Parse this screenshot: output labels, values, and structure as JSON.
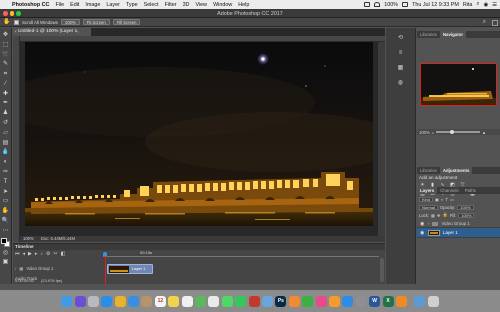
{
  "menubar": {
    "apple": "",
    "app_name": "Photoshop CC",
    "menus": [
      "File",
      "Edit",
      "Image",
      "Layer",
      "Type",
      "Select",
      "Filter",
      "3D",
      "View",
      "Window",
      "Help"
    ],
    "battery": "100%",
    "clock": "Thu Jul 12  9:33 PM",
    "user": "Rita"
  },
  "titlebar": {
    "title": "Adobe Photoshop CC 2017"
  },
  "options": {
    "scroll_all_label": "Scroll All Windows",
    "zoom_value": "100%",
    "fit_screen": "Fit Screen",
    "fill_screen": "Fill Screen"
  },
  "document": {
    "tab_title": "Untitled-1 @ 100% (Layer 1, RGB/8) *",
    "zoom": "100%",
    "doc_size": "Doc: 6.44M/6.44M"
  },
  "panels": {
    "top_tabs": [
      "Libraries",
      "Navigator"
    ],
    "navigator_zoom": "100%",
    "mid_tabs": [
      "Libraries",
      "Adjustments"
    ],
    "adjustments_title": "Add an adjustment",
    "layer_tabs": [
      "Layers",
      "Channels",
      "Paths"
    ],
    "layer_filter": "Kind",
    "blend_mode": "Normal",
    "opacity_label": "Opacity:",
    "opacity_value": "100%",
    "lock_label": "Lock:",
    "fill_label": "Fill:",
    "fill_value": "100%",
    "layers": [
      {
        "name": "Video Group 1",
        "type": "group"
      },
      {
        "name": "Layer 1",
        "type": "layer"
      }
    ]
  },
  "timeline": {
    "title": "Timeline",
    "current_time": "00:15s",
    "track_label": "Video Group 1",
    "clip_label": "Layer 1",
    "audio_label": "Audio Track",
    "timecode": "0:00:00:00",
    "fps": "(23.976 fps)",
    "playhead_fraction": 0.0
  },
  "dock": {
    "apps": [
      {
        "label": "Finder",
        "color": "#3f9be8",
        "glyph": ""
      },
      {
        "label": "Siri",
        "color": "#6a4fd6",
        "glyph": ""
      },
      {
        "label": "Launchpad",
        "color": "#b9b9c4",
        "glyph": ""
      },
      {
        "label": "Safari",
        "color": "#2b8ee6",
        "glyph": ""
      },
      {
        "label": "Chrome",
        "color": "#e8b42a",
        "glyph": ""
      },
      {
        "label": "Mail",
        "color": "#3a8fe0",
        "glyph": ""
      },
      {
        "label": "Contacts",
        "color": "#b8926a",
        "glyph": ""
      },
      {
        "label": "Calendar",
        "color": "#f4f4f4",
        "glyph": "12"
      },
      {
        "label": "Notes",
        "color": "#f3d34a",
        "glyph": ""
      },
      {
        "label": "Reminders",
        "color": "#f0f0f0",
        "glyph": ""
      },
      {
        "label": "Maps",
        "color": "#5cb85c",
        "glyph": ""
      },
      {
        "label": "Photos",
        "color": "#e9e9e9",
        "glyph": ""
      },
      {
        "label": "Messages",
        "color": "#4cd964",
        "glyph": ""
      },
      {
        "label": "FaceTime",
        "color": "#34c759",
        "glyph": ""
      },
      {
        "label": "Photo Booth",
        "color": "#c0392b",
        "glyph": ""
      },
      {
        "label": "Preview",
        "color": "#6aa6d8",
        "glyph": ""
      },
      {
        "label": "Photoshop",
        "color": "#0b2a44",
        "glyph": "Ps"
      },
      {
        "label": "Pages",
        "color": "#f28a30",
        "glyph": ""
      },
      {
        "label": "Numbers",
        "color": "#3cb043",
        "glyph": ""
      },
      {
        "label": "iTunes",
        "color": "#e84a8a",
        "glyph": ""
      },
      {
        "label": "iBooks",
        "color": "#f39c2b",
        "glyph": ""
      },
      {
        "label": "App Store",
        "color": "#2d8ce8",
        "glyph": ""
      },
      {
        "label": "System Preferences",
        "color": "#8e8e93",
        "glyph": ""
      },
      {
        "label": "Word",
        "color": "#2b579a",
        "glyph": "W"
      },
      {
        "label": "Excel",
        "color": "#217346",
        "glyph": "X"
      },
      {
        "label": "VLC",
        "color": "#f08a24",
        "glyph": ""
      },
      {
        "label": "Downloads",
        "color": "#5b9bd5",
        "glyph": ""
      },
      {
        "label": "Trash",
        "color": "#d0d0d0",
        "glyph": ""
      }
    ]
  }
}
